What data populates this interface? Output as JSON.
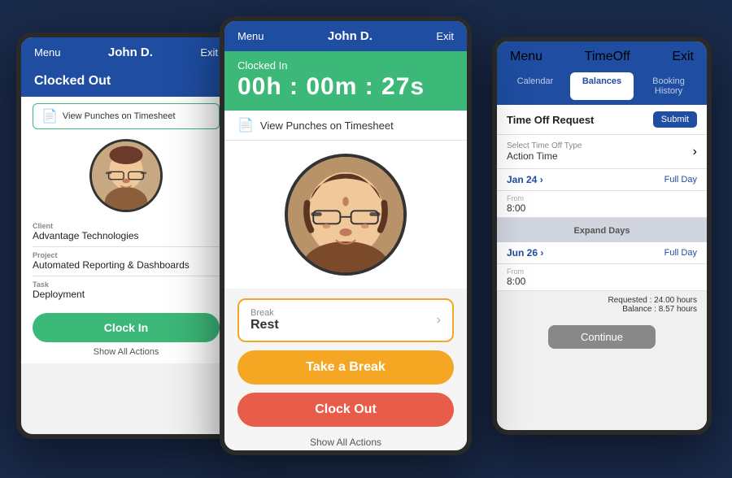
{
  "left_tablet": {
    "header": {
      "menu": "Menu",
      "title": "John D.",
      "exit": "Exit"
    },
    "status": "Clocked Out",
    "view_punches": "View Punches on Timesheet",
    "client_label": "Client",
    "client_value": "Advantage Technologies",
    "project_label": "Project",
    "project_value": "Automated Reporting & Dashboards",
    "task_label": "Task",
    "task_value": "Deployment",
    "clock_in_btn": "Clock In",
    "show_all": "Show All Actions"
  },
  "center_tablet": {
    "header": {
      "menu": "Menu",
      "title": "John D.",
      "exit": "Exit"
    },
    "status_label": "Clocked In",
    "time_display": "00h : 00m : 27s",
    "view_punches": "View Punches on Timesheet",
    "break_label": "Break",
    "break_value": "Rest",
    "take_break_btn": "Take a Break",
    "clock_out_btn": "Clock Out",
    "show_all": "Show All Actions"
  },
  "right_tablet": {
    "header": {
      "menu": "Menu",
      "title": "TimeOff",
      "exit": "Exit"
    },
    "tabs": {
      "calendar": "Calendar",
      "balances": "Balances",
      "booking_history": "Booking History"
    },
    "request_title": "Time Off Request",
    "submit_btn": "Submit",
    "type_label": "Select Time Off Type",
    "action_time_label": "Action Time",
    "date1": "Jan 24",
    "full_day1": "Full Day",
    "from_label1": "From",
    "from_val1": "8:00",
    "expand_label": "Expand Days",
    "date2": "Jun 26",
    "full_day2": "Full Day",
    "from_label2": "From",
    "from_val2": "8:00",
    "requested": "Requested : 24.00 hours",
    "balance": "Balance : 8.57 hours",
    "continue_btn": "Continue"
  }
}
